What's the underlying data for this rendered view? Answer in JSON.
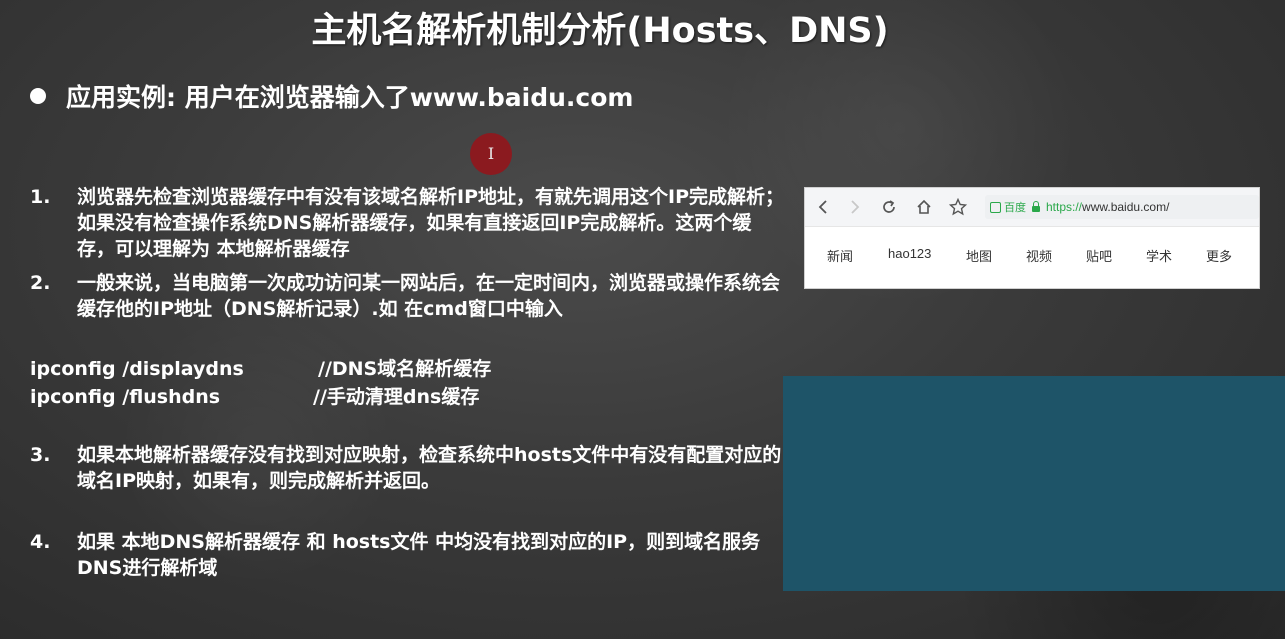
{
  "slide": {
    "title": "主机名解析机制分析(Hosts、DNS)",
    "bullet": "应用实例: 用户在浏览器输入了www.baidu.com",
    "cursor_icon": "text-cursor-icon",
    "items": [
      {
        "num": "1.",
        "text": "浏览器先检查浏览器缓存中有没有该域名解析IP地址，有就先调用这个IP完成解析；如果没有检查操作系统DNS解析器缓存，如果有直接返回IP完成解析。这两个缓存，可以理解为 本地解析器缓存"
      },
      {
        "num": "2.",
        "text": " 一般来说，当电脑第一次成功访问某一网站后，在一定时间内，浏览器或操作系统会缓存他的IP地址（DNS解析记录）.如 在cmd窗口中输入"
      },
      {
        "num": "3.",
        "text": "如果本地解析器缓存没有找到对应映射，检查系统中hosts文件中有没有配置对应的域名IP映射，如果有，则完成解析并返回。"
      },
      {
        "num": "4.",
        "text": "如果 本地DNS解析器缓存 和 hosts文件 中均没有找到对应的IP，则到域名服务DNS进行解析域"
      }
    ],
    "commands": [
      {
        "cmd": "ipconfig /displaydns",
        "comment": "//DNS域名解析缓存"
      },
      {
        "cmd": "ipconfig /flushdns",
        "comment": "//手动清理dns缓存"
      }
    ]
  },
  "browser": {
    "nav": {
      "back_icon": "chevron-left-icon",
      "forward_icon": "chevron-right-icon",
      "reload_icon": "reload-icon",
      "home_icon": "home-icon",
      "star_icon": "star-icon"
    },
    "site_label": "百度",
    "url_scheme": "https://",
    "url_rest": "www.baidu.com/",
    "links": [
      "新闻",
      "hao123",
      "地图",
      "视频",
      "贴吧",
      "学术",
      "更多"
    ]
  },
  "colors": {
    "background": "#3a3a3a",
    "teal_block": "#1e5468",
    "cursor_marker": "#8b1a1f",
    "secure_green": "#2aa84a"
  }
}
